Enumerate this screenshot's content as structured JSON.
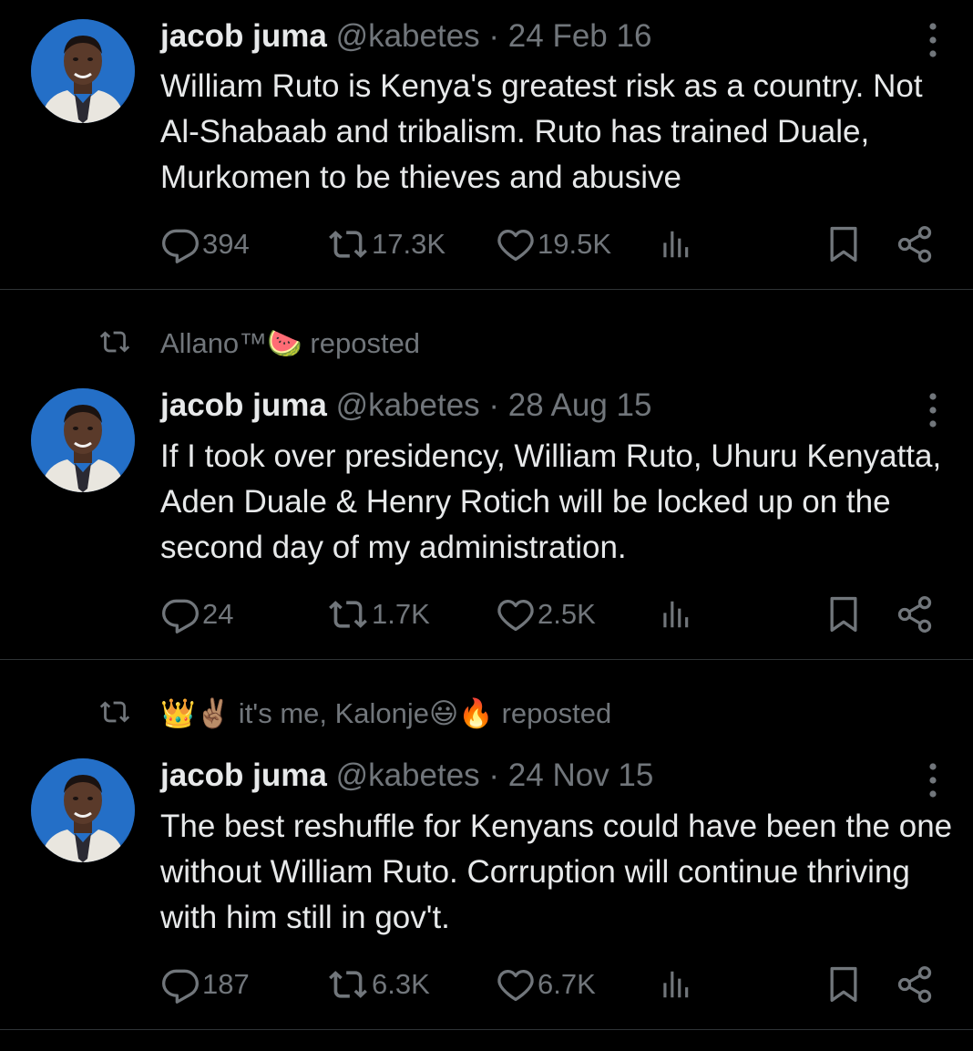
{
  "colors": {
    "background": "#000000",
    "text": "#e7e9ea",
    "muted": "#71767b",
    "divider": "#2f3336"
  },
  "tweets": [
    {
      "reposted_by": "",
      "reposted_by_suffix": "",
      "name": "jacob juma",
      "handle": "@kabetes",
      "date": "· 24 Feb 16",
      "text": "William Ruto is Kenya's greatest risk as a country. Not Al-Shabaab and tribalism. Ruto has trained Duale, Murkomen to be thieves and abusive",
      "replies": "394",
      "reposts": "17.3K",
      "likes": "19.5K"
    },
    {
      "reposted_by": "Allano™🍉",
      "reposted_by_suffix": "reposted",
      "name": "jacob juma",
      "handle": "@kabetes",
      "date": "· 28 Aug 15",
      "text": "If I took over presidency, William Ruto, Uhuru Kenyatta, Aden Duale & Henry Rotich will be locked up on the second day of my administration.",
      "replies": "24",
      "reposts": "1.7K",
      "likes": "2.5K"
    },
    {
      "reposted_by": "👑✌🏽 it's me, Kalonje😃🔥",
      "reposted_by_suffix": "reposted",
      "name": "jacob juma",
      "handle": "@kabetes",
      "date": "· 24 Nov 15",
      "text": "The best reshuffle for Kenyans could have been the one without William Ruto. Corruption will continue thriving with him still in gov't.",
      "replies": "187",
      "reposts": "6.3K",
      "likes": "6.7K"
    }
  ],
  "icons": [
    "reply-icon",
    "repost-icon",
    "like-icon",
    "views-icon",
    "bookmark-icon",
    "share-icon",
    "more-icon",
    "avatar-photo"
  ]
}
